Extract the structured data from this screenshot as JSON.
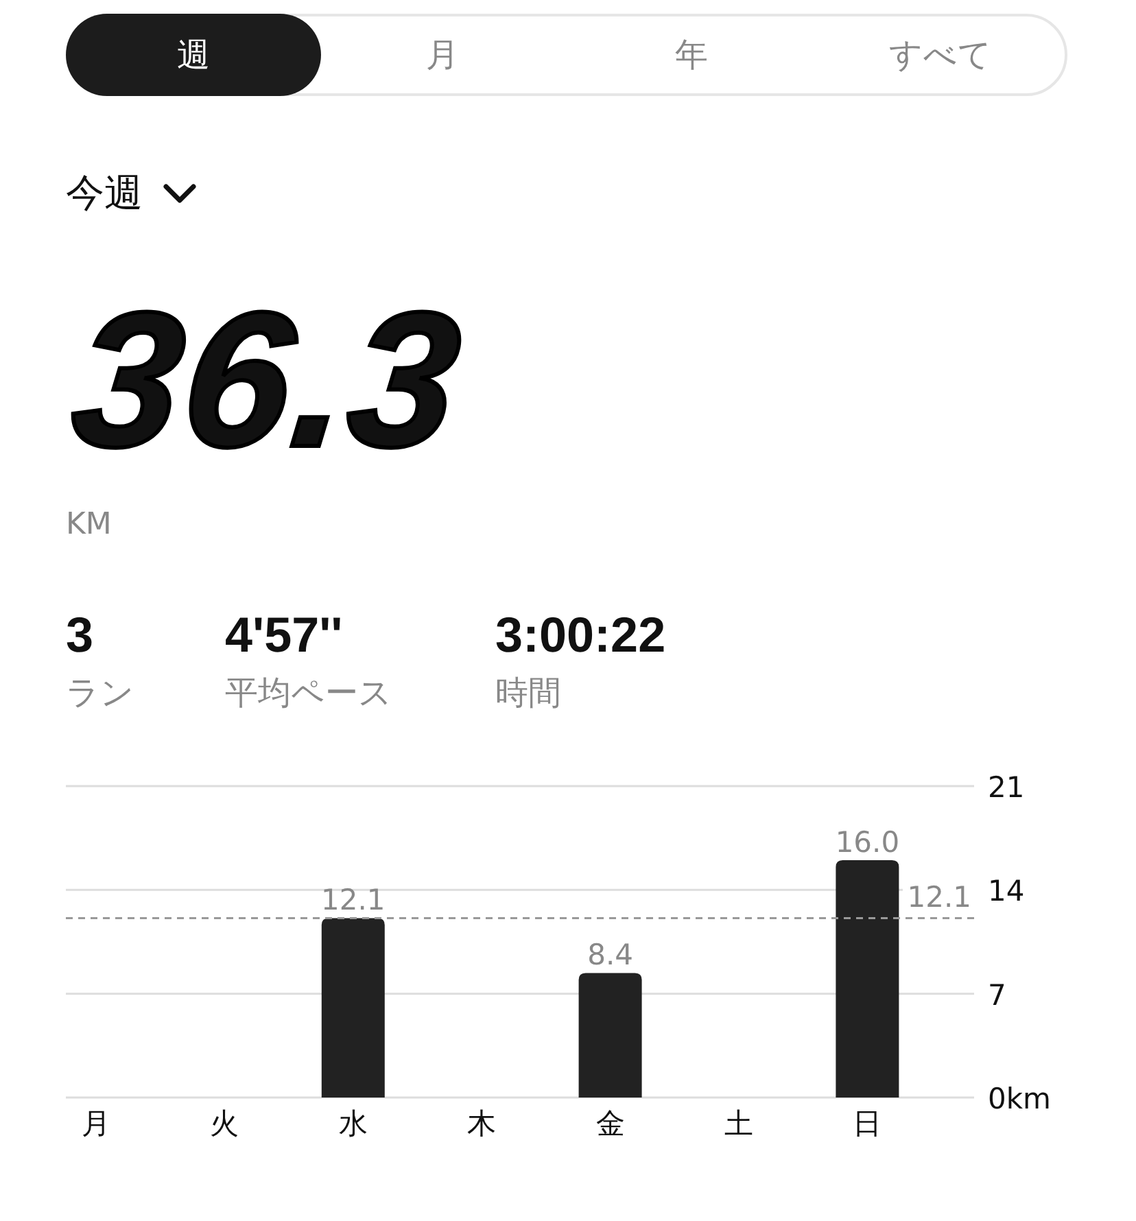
{
  "tabs": [
    {
      "label": "週",
      "selected": true
    },
    {
      "label": "月",
      "selected": false
    },
    {
      "label": "年",
      "selected": false
    },
    {
      "label": "すべて",
      "selected": false
    }
  ],
  "period": {
    "label": "今週"
  },
  "total": {
    "value": "36.3",
    "unit": "KM"
  },
  "stats": [
    {
      "value": "3",
      "label": "ラン"
    },
    {
      "value": "4'57''",
      "label": "平均ペース"
    },
    {
      "value": "3:00:22",
      "label": "時間"
    }
  ],
  "chart_data": {
    "type": "bar",
    "categories": [
      "月",
      "火",
      "水",
      "木",
      "金",
      "土",
      "日"
    ],
    "values": [
      null,
      null,
      12.1,
      null,
      8.4,
      null,
      16.0
    ],
    "value_labels": [
      null,
      null,
      "12.1",
      null,
      "8.4",
      null,
      "16.0"
    ],
    "ylim": [
      0,
      21
    ],
    "yticks": [
      {
        "value": 0,
        "label": "0km"
      },
      {
        "value": 7,
        "label": "7"
      },
      {
        "value": 14,
        "label": "14"
      },
      {
        "value": 21,
        "label": "21"
      }
    ],
    "ref_lines": [
      {
        "axis": "y",
        "value": 12.1,
        "label": "12.1"
      }
    ]
  }
}
